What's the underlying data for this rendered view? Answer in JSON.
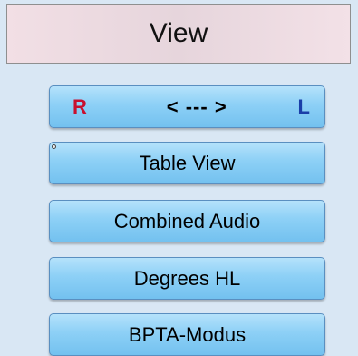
{
  "header": {
    "title": "View"
  },
  "rl_button": {
    "right_label": "R",
    "arrows_label": "< --- >",
    "left_label": "L"
  },
  "buttons": {
    "table_view": "Table View",
    "combined_audio": "Combined Audio",
    "degrees_hl": "Degrees HL",
    "bpta_modus": "BPTA-Modus"
  },
  "colors": {
    "right_letter": "#c8102e",
    "left_letter": "#1a3ea8",
    "button_fill": "#8dd0f6",
    "panel_background": "#d9e7f4",
    "header_background": "#e6d5dc"
  }
}
